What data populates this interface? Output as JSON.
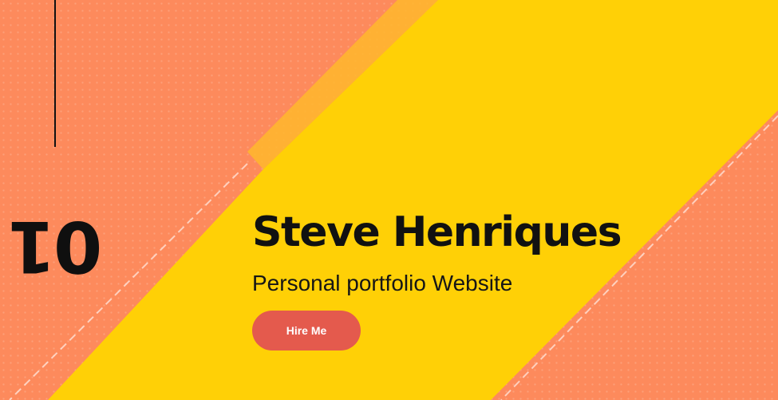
{
  "hero": {
    "slide_number": "01",
    "title": "Steve Henriques",
    "subtitle": "Personal portfolio Website",
    "cta_label": "Hire Me"
  },
  "colors": {
    "background_orange": "#fd8a5c",
    "accent_yellow": "#ffd006",
    "button_red": "#e45a4d",
    "text_dark": "#111111"
  }
}
